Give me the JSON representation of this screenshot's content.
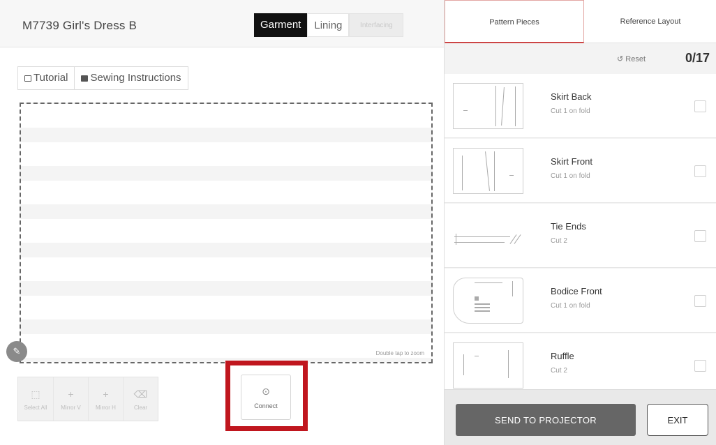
{
  "header": {
    "title": "M7739 Girl's Dress B",
    "segments": {
      "garment": "Garment",
      "lining": "Lining",
      "interfacing": "Interfacing"
    }
  },
  "subtabs": {
    "tutorial": "Tutorial",
    "sewing": "Sewing Instructions"
  },
  "canvas": {
    "hint": "Double tap to zoom"
  },
  "toolbar": {
    "select_all": "Select All",
    "mirror_v": "Mirror V",
    "mirror_h": "Mirror H",
    "clear": "Clear",
    "connect": "Connect"
  },
  "right_tabs": {
    "pattern_pieces": "Pattern Pieces",
    "reference_layout": "Reference Layout"
  },
  "status": {
    "reset_label": "Reset",
    "count": "0/17"
  },
  "pieces": [
    {
      "name": "Skirt Back",
      "cut": "Cut 1 on fold"
    },
    {
      "name": "Skirt Front",
      "cut": "Cut 1 on fold"
    },
    {
      "name": "Tie Ends",
      "cut": "Cut 2"
    },
    {
      "name": "Bodice Front",
      "cut": "Cut 1 on fold"
    },
    {
      "name": "Ruffle",
      "cut": "Cut 2"
    }
  ],
  "footer": {
    "send": "SEND TO PROJECTOR",
    "exit": "EXIT"
  },
  "colors": {
    "highlight": "#c0161e",
    "active_segment": "#111111",
    "send_button": "#666666"
  }
}
